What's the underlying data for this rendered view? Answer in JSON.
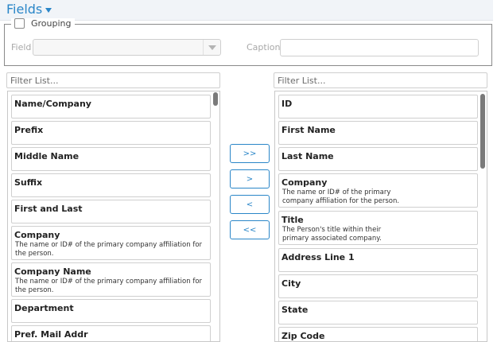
{
  "header": {
    "title": "Fields"
  },
  "grouping": {
    "label": "Grouping",
    "field_label": "Field",
    "field_value": "",
    "caption_label": "Caption",
    "caption_value": ""
  },
  "available": {
    "filter_placeholder": "Filter List...",
    "items": [
      {
        "name": "Name/Company",
        "desc": ""
      },
      {
        "name": "Prefix",
        "desc": ""
      },
      {
        "name": "Middle Name",
        "desc": ""
      },
      {
        "name": "Suffix",
        "desc": ""
      },
      {
        "name": "First and Last",
        "desc": ""
      },
      {
        "name": "Company",
        "desc": "The name or ID# of the primary company affiliation for the person."
      },
      {
        "name": "Company Name",
        "desc": "The name or ID# of the primary company affiliation for the person."
      },
      {
        "name": "Department",
        "desc": ""
      },
      {
        "name": "Pref. Mail Addr",
        "desc": ""
      }
    ]
  },
  "selected": {
    "filter_placeholder": "Filter List...",
    "items": [
      {
        "name": "ID",
        "desc": ""
      },
      {
        "name": "First Name",
        "desc": ""
      },
      {
        "name": "Last Name",
        "desc": ""
      },
      {
        "name": "Company",
        "desc": "The name or ID# of the primary company affiliation for the person."
      },
      {
        "name": "Title",
        "desc": "The Person's title within their primary associated company."
      },
      {
        "name": "Address Line 1",
        "desc": ""
      },
      {
        "name": "City",
        "desc": ""
      },
      {
        "name": "State",
        "desc": ""
      },
      {
        "name": "Zip Code",
        "desc": ""
      }
    ]
  },
  "buttons": {
    "add_all": ">>",
    "add": ">",
    "remove": "<",
    "remove_all": "<<"
  },
  "colors": {
    "accent": "#2a86c8",
    "header_bg": "#f1f4f8"
  }
}
